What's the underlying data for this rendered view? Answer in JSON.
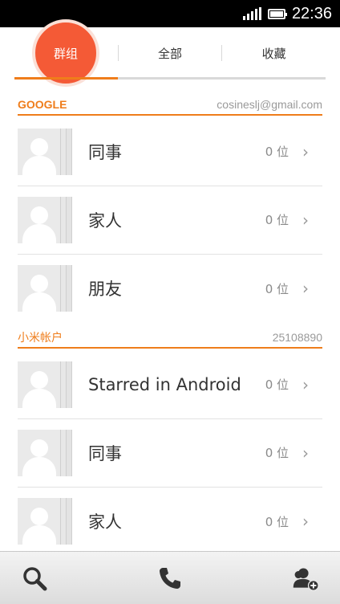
{
  "status_bar": {
    "time": "22:36"
  },
  "tabs": [
    {
      "label": "群组"
    },
    {
      "label": "全部"
    },
    {
      "label": "收藏"
    }
  ],
  "sections": [
    {
      "title": "GOOGLE",
      "account": "cosineslj@gmail.com",
      "groups": [
        {
          "name": "同事",
          "count": "0 位"
        },
        {
          "name": "家人",
          "count": "0 位"
        },
        {
          "name": "朋友",
          "count": "0 位"
        }
      ]
    },
    {
      "title": "小米帐户",
      "account": "25108890",
      "groups": [
        {
          "name": "Starred in Android",
          "count": "0 位"
        },
        {
          "name": "同事",
          "count": "0 位"
        },
        {
          "name": "家人",
          "count": "0 位"
        }
      ]
    }
  ],
  "colors": {
    "accent": "#ef7d1b",
    "tab_highlight": "#f45a36"
  },
  "bottom_bar": {
    "icons": [
      "search-icon",
      "phone-icon",
      "add-contact-icon"
    ]
  }
}
